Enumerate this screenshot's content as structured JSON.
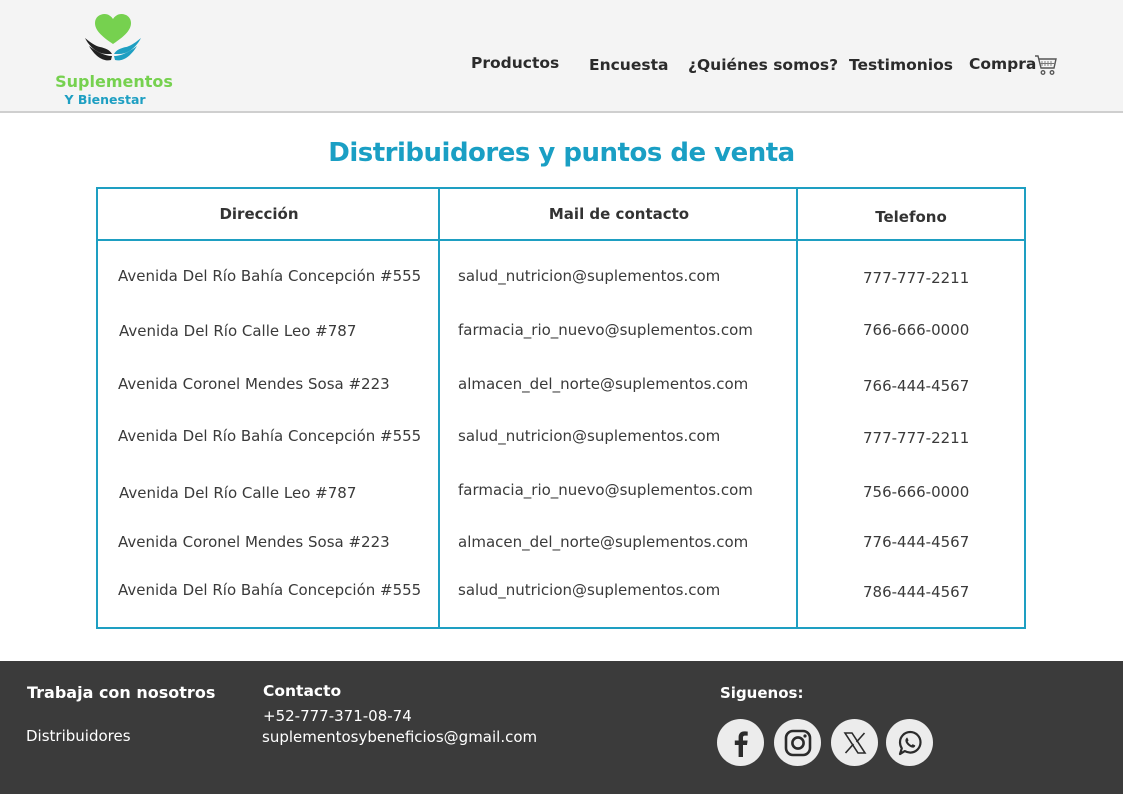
{
  "header": {
    "logo": {
      "line1": "Suplementos",
      "line2": "Y Bienestar",
      "icon": "heart-hands-icon"
    },
    "nav": [
      {
        "label": "Productos"
      },
      {
        "label": "Encuesta"
      },
      {
        "label": "¿Quiénes somos?"
      },
      {
        "label": "Testimonios"
      },
      {
        "label": "Compra"
      }
    ],
    "cart_icon": "cart-icon"
  },
  "main": {
    "title": "Distribuidores y puntos de venta",
    "table": {
      "columns": [
        "Dirección",
        "Mail de contacto",
        "Telefono"
      ],
      "rows": [
        [
          "Avenida Del Río Bahía Concepción #555",
          "salud_nutricion@suplementos.com",
          "777-777-2211"
        ],
        [
          "Avenida Del Río Calle Leo  #787",
          "farmacia_rio_nuevo@suplementos.com",
          "766-666-0000"
        ],
        [
          "Avenida Coronel Mendes Sosa #223",
          "almacen_del_norte@suplementos.com",
          "766-444-4567"
        ],
        [
          "Avenida Del Río Bahía Concepción #555",
          "salud_nutricion@suplementos.com",
          "777-777-2211"
        ],
        [
          "Avenida Del Río Calle Leo  #787",
          "farmacia_rio_nuevo@suplementos.com",
          "756-666-0000"
        ],
        [
          "Avenida Coronel Mendes Sosa #223",
          "almacen_del_norte@suplementos.com",
          "776-444-4567"
        ],
        [
          "Avenida Del Río Bahía Concepción #555",
          "salud_nutricion@suplementos.com",
          "786-444-4567"
        ]
      ]
    }
  },
  "footer": {
    "work": {
      "heading": "Trabaja con nosotros",
      "link": "Distribuidores"
    },
    "contact": {
      "heading": "Contacto",
      "phone": "+52-777-371-08-74",
      "email": "suplementosybeneficios@gmail.com"
    },
    "social": {
      "heading": "Siguenos:",
      "icons": [
        "facebook-icon",
        "instagram-icon",
        "x-icon",
        "whatsapp-icon"
      ]
    }
  },
  "colors": {
    "accent": "#1e9fc2",
    "brand_green": "#76d14f",
    "footer_bg": "#3b3b3b",
    "header_bg": "#f4f4f4"
  }
}
